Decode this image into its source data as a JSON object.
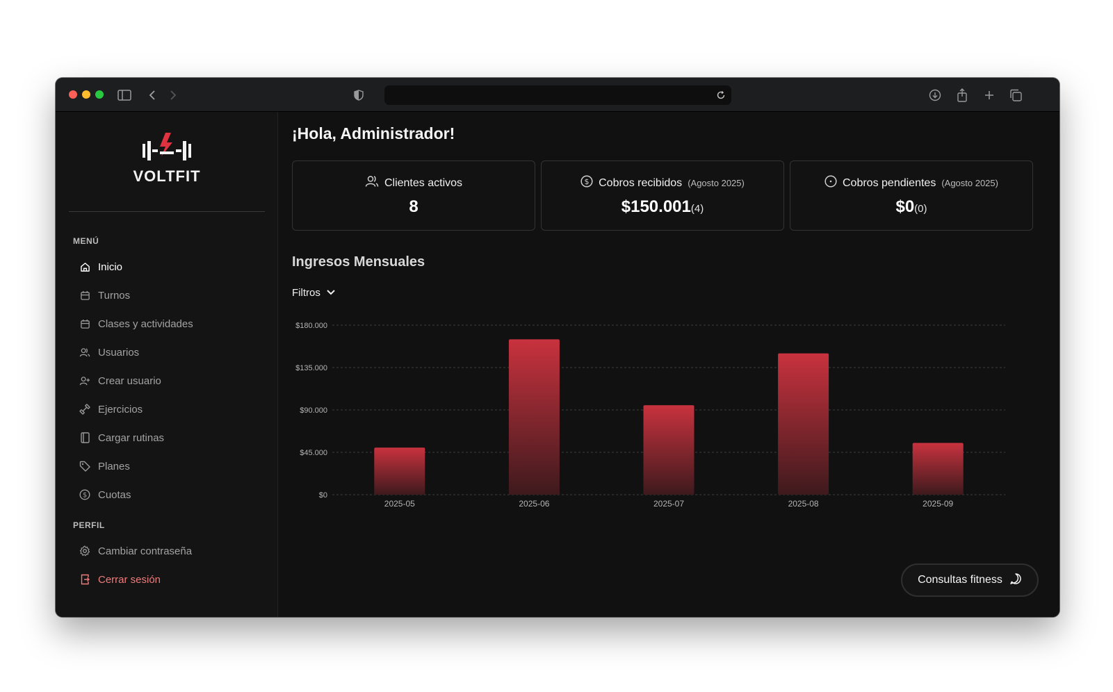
{
  "browser": {
    "address_value": ""
  },
  "sidebar": {
    "logo_text": "VOLTFIT",
    "menu_label": "MENÚ",
    "items": [
      {
        "label": "Inicio",
        "icon": "home-icon",
        "active": true
      },
      {
        "label": "Turnos",
        "icon": "calendar-icon"
      },
      {
        "label": "Clases y actividades",
        "icon": "calendar-icon"
      },
      {
        "label": "Usuarios",
        "icon": "users-icon"
      },
      {
        "label": "Crear usuario",
        "icon": "user-plus-icon"
      },
      {
        "label": "Ejercicios",
        "icon": "dumbbell-icon"
      },
      {
        "label": "Cargar rutinas",
        "icon": "notebook-icon"
      },
      {
        "label": "Planes",
        "icon": "tag-icon"
      },
      {
        "label": "Cuotas",
        "icon": "dollar-circle-icon"
      }
    ],
    "profile_label": "PERFIL",
    "profile_items": [
      {
        "label": "Cambiar contraseña",
        "icon": "gear-icon"
      },
      {
        "label": "Cerrar sesión",
        "icon": "logout-icon"
      }
    ]
  },
  "main": {
    "greeting": "¡Hola, Administrador!",
    "cards": [
      {
        "title": "Clientes activos",
        "sub": "",
        "value": "8",
        "count": "",
        "icon": "users-icon"
      },
      {
        "title": "Cobros recibidos",
        "sub": "(Agosto 2025)",
        "value": "$150.001",
        "count": "(4)",
        "icon": "dollar-circle-icon"
      },
      {
        "title": "Cobros pendientes",
        "sub": "(Agosto 2025)",
        "value": "$0",
        "count": "(0)",
        "icon": "clock-icon"
      }
    ],
    "chart_title": "Ingresos Mensuales",
    "filters_label": "Filtros",
    "consult_label": "Consultas fitness"
  },
  "colors": {
    "accent": "#c0313b",
    "background": "#111111",
    "sidebar": "#141414",
    "logout": "#f07b7b"
  },
  "chart_data": {
    "type": "bar",
    "categories": [
      "2025-05",
      "2025-06",
      "2025-07",
      "2025-08",
      "2025-09"
    ],
    "values": [
      50000,
      165000,
      95000,
      150000,
      55000
    ],
    "yticks": [
      "$0",
      "$45.000",
      "$90.000",
      "$135.000",
      "$180.000"
    ],
    "ylim": [
      0,
      180000
    ],
    "grid": true,
    "bar_color": "#c0313b"
  }
}
